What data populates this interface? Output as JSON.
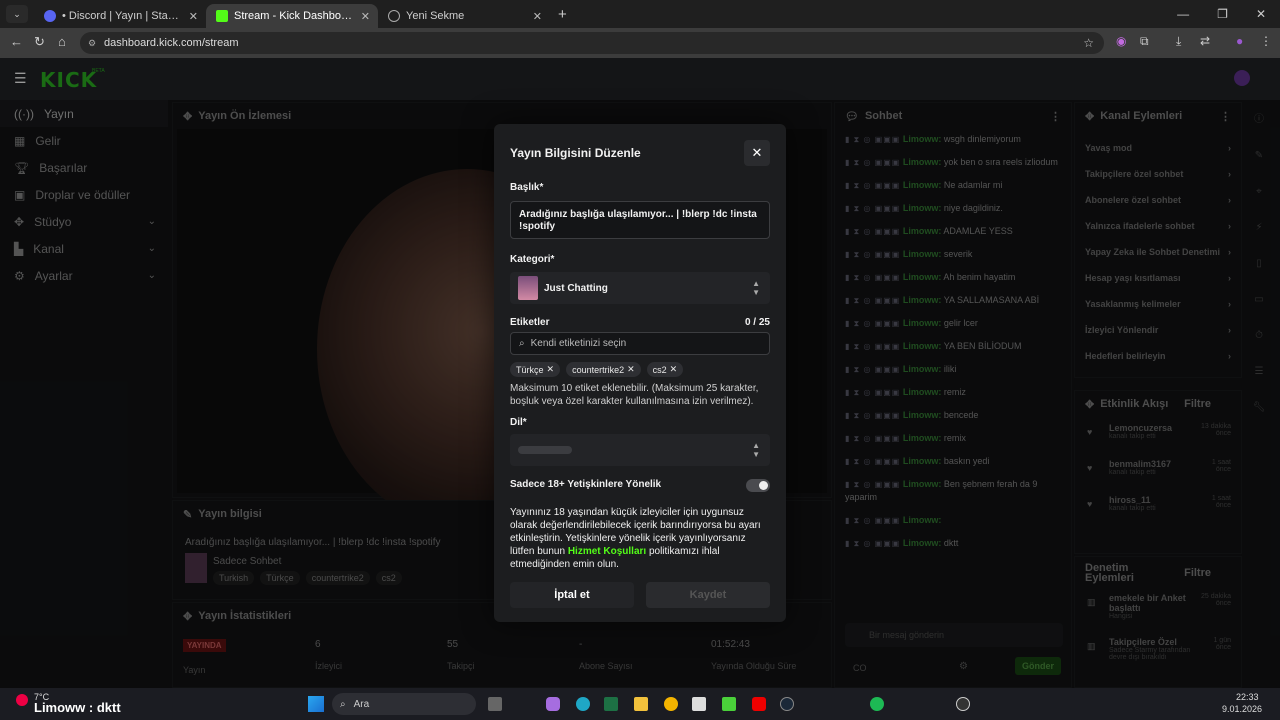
{
  "browser": {
    "tabs": [
      {
        "label": "• Discord | Yayın | Starmy &",
        "active": false
      },
      {
        "label": "Stream - Kick Dashboard",
        "active": true
      },
      {
        "label": "Yeni Sekme",
        "active": false
      }
    ],
    "url": "dashboard.kick.com/stream"
  },
  "kick": {
    "logo": "KICK",
    "beta": "BETA"
  },
  "sidebar": {
    "items": [
      {
        "label": "Yayın",
        "icon": "broadcast-icon"
      },
      {
        "label": "Gelir",
        "icon": "grid-icon"
      },
      {
        "label": "Başarılar",
        "icon": "trophy-icon"
      },
      {
        "label": "Droplar ve ödüller",
        "icon": "gift-icon"
      },
      {
        "label": "Stüdyo",
        "icon": "studio-icon"
      },
      {
        "label": "Kanal",
        "icon": "channel-icon"
      },
      {
        "label": "Ayarlar",
        "icon": "gear-icon"
      }
    ]
  },
  "preview": {
    "title": "Yayın Ön İzlemesi"
  },
  "stream_info": {
    "title": "Yayın bilgisi",
    "stream_title": "Aradığınız başlığa ulaşılamıyor... | !blerp !dc !insta !spotify",
    "category": "Sadece Sohbet",
    "tags": [
      "Turkish",
      "Türkçe",
      "countertrike2",
      "cs2"
    ]
  },
  "stats": {
    "title": "Yayın İstatistikleri",
    "live": "YAYINDA",
    "items": [
      {
        "value": "Yayın",
        "label": ""
      },
      {
        "value": "6",
        "label": "İzleyici"
      },
      {
        "value": "55",
        "label": "Takipçi"
      },
      {
        "value": "-",
        "label": "Abone Sayısı"
      },
      {
        "value": "01:52:43",
        "label": "Yayında Olduğu Süre"
      }
    ]
  },
  "modal": {
    "title": "Yayın Bilgisini Düzenle",
    "title_label": "Başlık*",
    "title_value": "Aradığınız başlığa ulaşılamıyor... | !blerp !dc !insta !spotify",
    "category_label": "Kategori*",
    "category_value": "Just Chatting",
    "tags_label": "Etiketler",
    "tags_count": "0 / 25",
    "tags_placeholder": "Kendi etiketinizi seçin",
    "tags": [
      "Türkçe",
      "countertrike2",
      "cs2"
    ],
    "tags_note": "Maksimum 10 etiket eklenebilir. (Maksimum 25 karakter, boşluk veya özel karakter kullanılmasına izin verilmez).",
    "lang_label": "Dil*",
    "adult_label": "Sadece 18+ Yetişkinlere Yönelik",
    "adult_note_1": "Yayınınız 18 yaşından küçük izleyiciler için uygunsuz olarak değerlendirilebilecek içerik barındırıyorsa bu ayarı etkinleştirin. Yetişkinlere yönelik içerik yayınlıyorsanız lütfen bunun ",
    "adult_link": "Hizmet Koşulları",
    "adult_note_2": " politikamızı ihlal etmediğinden emin olun.",
    "cancel": "İptal et",
    "save": "Kaydet"
  },
  "chat": {
    "title": "Sohbet",
    "messages": [
      {
        "user": "Limoww:",
        "text": "wsgh dinlemiyorum"
      },
      {
        "user": "Limoww:",
        "text": "yok ben o sıra reels izliodum"
      },
      {
        "user": "Limoww:",
        "text": "Ne adamlar mi"
      },
      {
        "user": "Limoww:",
        "text": "niye dagildiniz."
      },
      {
        "user": "Limoww:",
        "text": "ADAMLAE YESS"
      },
      {
        "user": "Limoww:",
        "text": "severik"
      },
      {
        "user": "Limoww:",
        "text": "Ah benim hayatim"
      },
      {
        "user": "Limoww:",
        "text": "YA SALLAMASANA ABİ"
      },
      {
        "user": "Limoww:",
        "text": "gelir lcer"
      },
      {
        "user": "Limoww:",
        "text": "YA BEN BİLİODUM"
      },
      {
        "user": "Limoww:",
        "text": "iliki"
      },
      {
        "user": "Limoww:",
        "text": "remiz"
      },
      {
        "user": "Limoww:",
        "text": "bencede"
      },
      {
        "user": "Limoww:",
        "text": "remix"
      },
      {
        "user": "Limoww:",
        "text": "baskın yedi"
      },
      {
        "user": "Limoww:",
        "text": "Ben şebnem ferah da 9 yaparim"
      },
      {
        "user": "Limoww:",
        "text": ""
      },
      {
        "user": "Limoww:",
        "text": "dktt"
      }
    ],
    "input_placeholder": "Bir mesaj gönderin",
    "send": "Gönder",
    "points": "CO"
  },
  "actions": {
    "title": "Kanal Eylemleri",
    "items": [
      "Yavaş mod",
      "Takipçilere özel sohbet",
      "Abonelere özel sohbet",
      "Yalnızca ifadelerle sohbet",
      "Yapay Zeka ile Sohbet Denetimi",
      "Hesap yaşı kısıtlaması",
      "Yasaklanmış kelimeler",
      "İzleyici Yönlendir",
      "Hedefleri belirleyin"
    ]
  },
  "activity": {
    "title": "Etkinlik Akışı",
    "filter": "Filtre",
    "items": [
      {
        "name": "Lemoncuzersa",
        "sub": "kanalı takip etti",
        "time": "13 dakika önce"
      },
      {
        "name": "benmalim3167",
        "sub": "kanalı takip etti",
        "time": "1 saat önce"
      },
      {
        "name": "hiross_11",
        "sub": "kanalı takip etti",
        "time": "1 saat önce"
      }
    ]
  },
  "moderation": {
    "title": "Denetim Eylemleri",
    "filter": "Filtre",
    "items": [
      {
        "name": "emekele bir Anket başlattı",
        "sub": "Hangisi",
        "time": "25 dakika önce"
      },
      {
        "name": "Takipçilere Özel",
        "sub": "Sadece Starmy tarafından devre dışı bırakıldı",
        "time": "1 gün önce"
      }
    ]
  },
  "taskbar": {
    "weather": "7°C",
    "now_playing": "Limoww : dktt",
    "search": "Ara",
    "time": "22:33",
    "date": "9.01.2026"
  }
}
